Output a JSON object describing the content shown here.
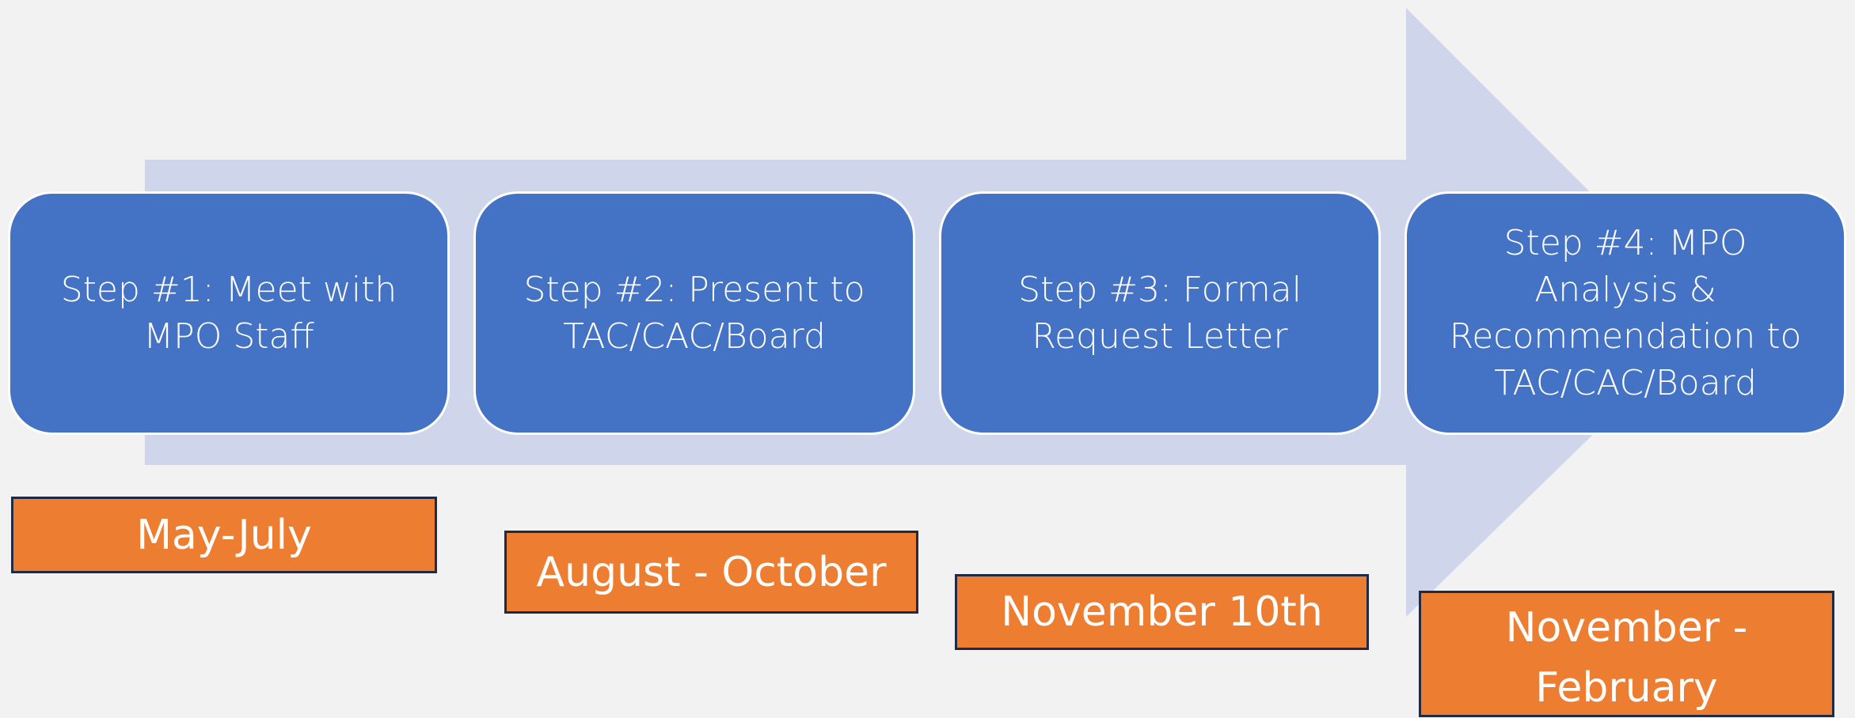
{
  "colors": {
    "background": "#f2f2f2",
    "arrow": "#cfd5ea",
    "step_fill": "#4472c4",
    "step_text": "#ffffff",
    "date_fill": "#ed7d31",
    "date_border": "#1f2a44"
  },
  "steps": [
    {
      "text": "Step #1: Meet with MPO Staff"
    },
    {
      "text": "Step #2: Present to TAC/CAC/Board"
    },
    {
      "text": "Step #3: Formal Request Letter"
    },
    {
      "text": "Step #4: MPO Analysis & Recommendation to TAC/CAC/Board"
    }
  ],
  "dates": [
    {
      "text": "May-July"
    },
    {
      "text": "August - October"
    },
    {
      "text": "November 10th"
    },
    {
      "text": "November - February"
    }
  ]
}
